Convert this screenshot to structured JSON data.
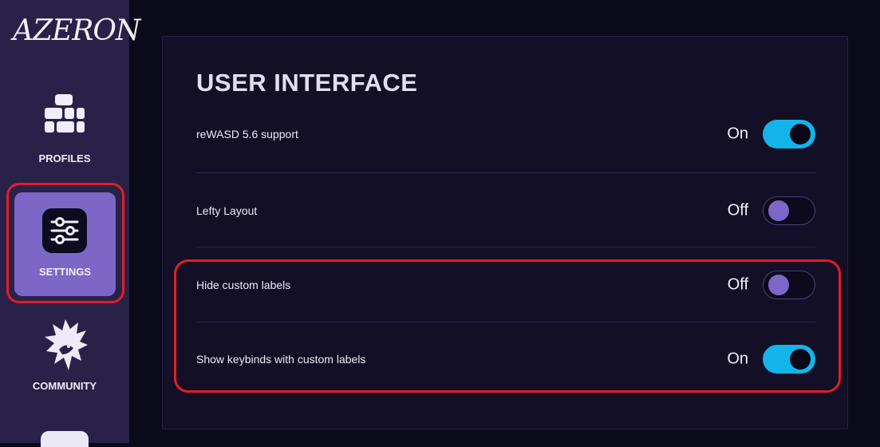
{
  "app": {
    "logo_text": "AZERON"
  },
  "sidebar": {
    "items": [
      {
        "label": "PROFILES",
        "icon": "grid-icon"
      },
      {
        "label": "SETTINGS",
        "icon": "sliders-icon",
        "active": true
      },
      {
        "label": "COMMUNITY",
        "icon": "dragon-icon"
      }
    ]
  },
  "panel": {
    "title": "USER INTERFACE",
    "settings": [
      {
        "label": "reWASD 5.6 support",
        "state": "On"
      },
      {
        "label": "Lefty Layout",
        "state": "Off"
      },
      {
        "label": "Hide custom labels",
        "state": "Off"
      },
      {
        "label": "Show keybinds with custom labels",
        "state": "On"
      }
    ]
  },
  "colors": {
    "sidebar_bg": "#2a2148",
    "active_nav": "#7c66c6",
    "toggle_on": "#12b5ea",
    "toggle_off_knob": "#7d67c8",
    "highlight": "#e31e24"
  }
}
